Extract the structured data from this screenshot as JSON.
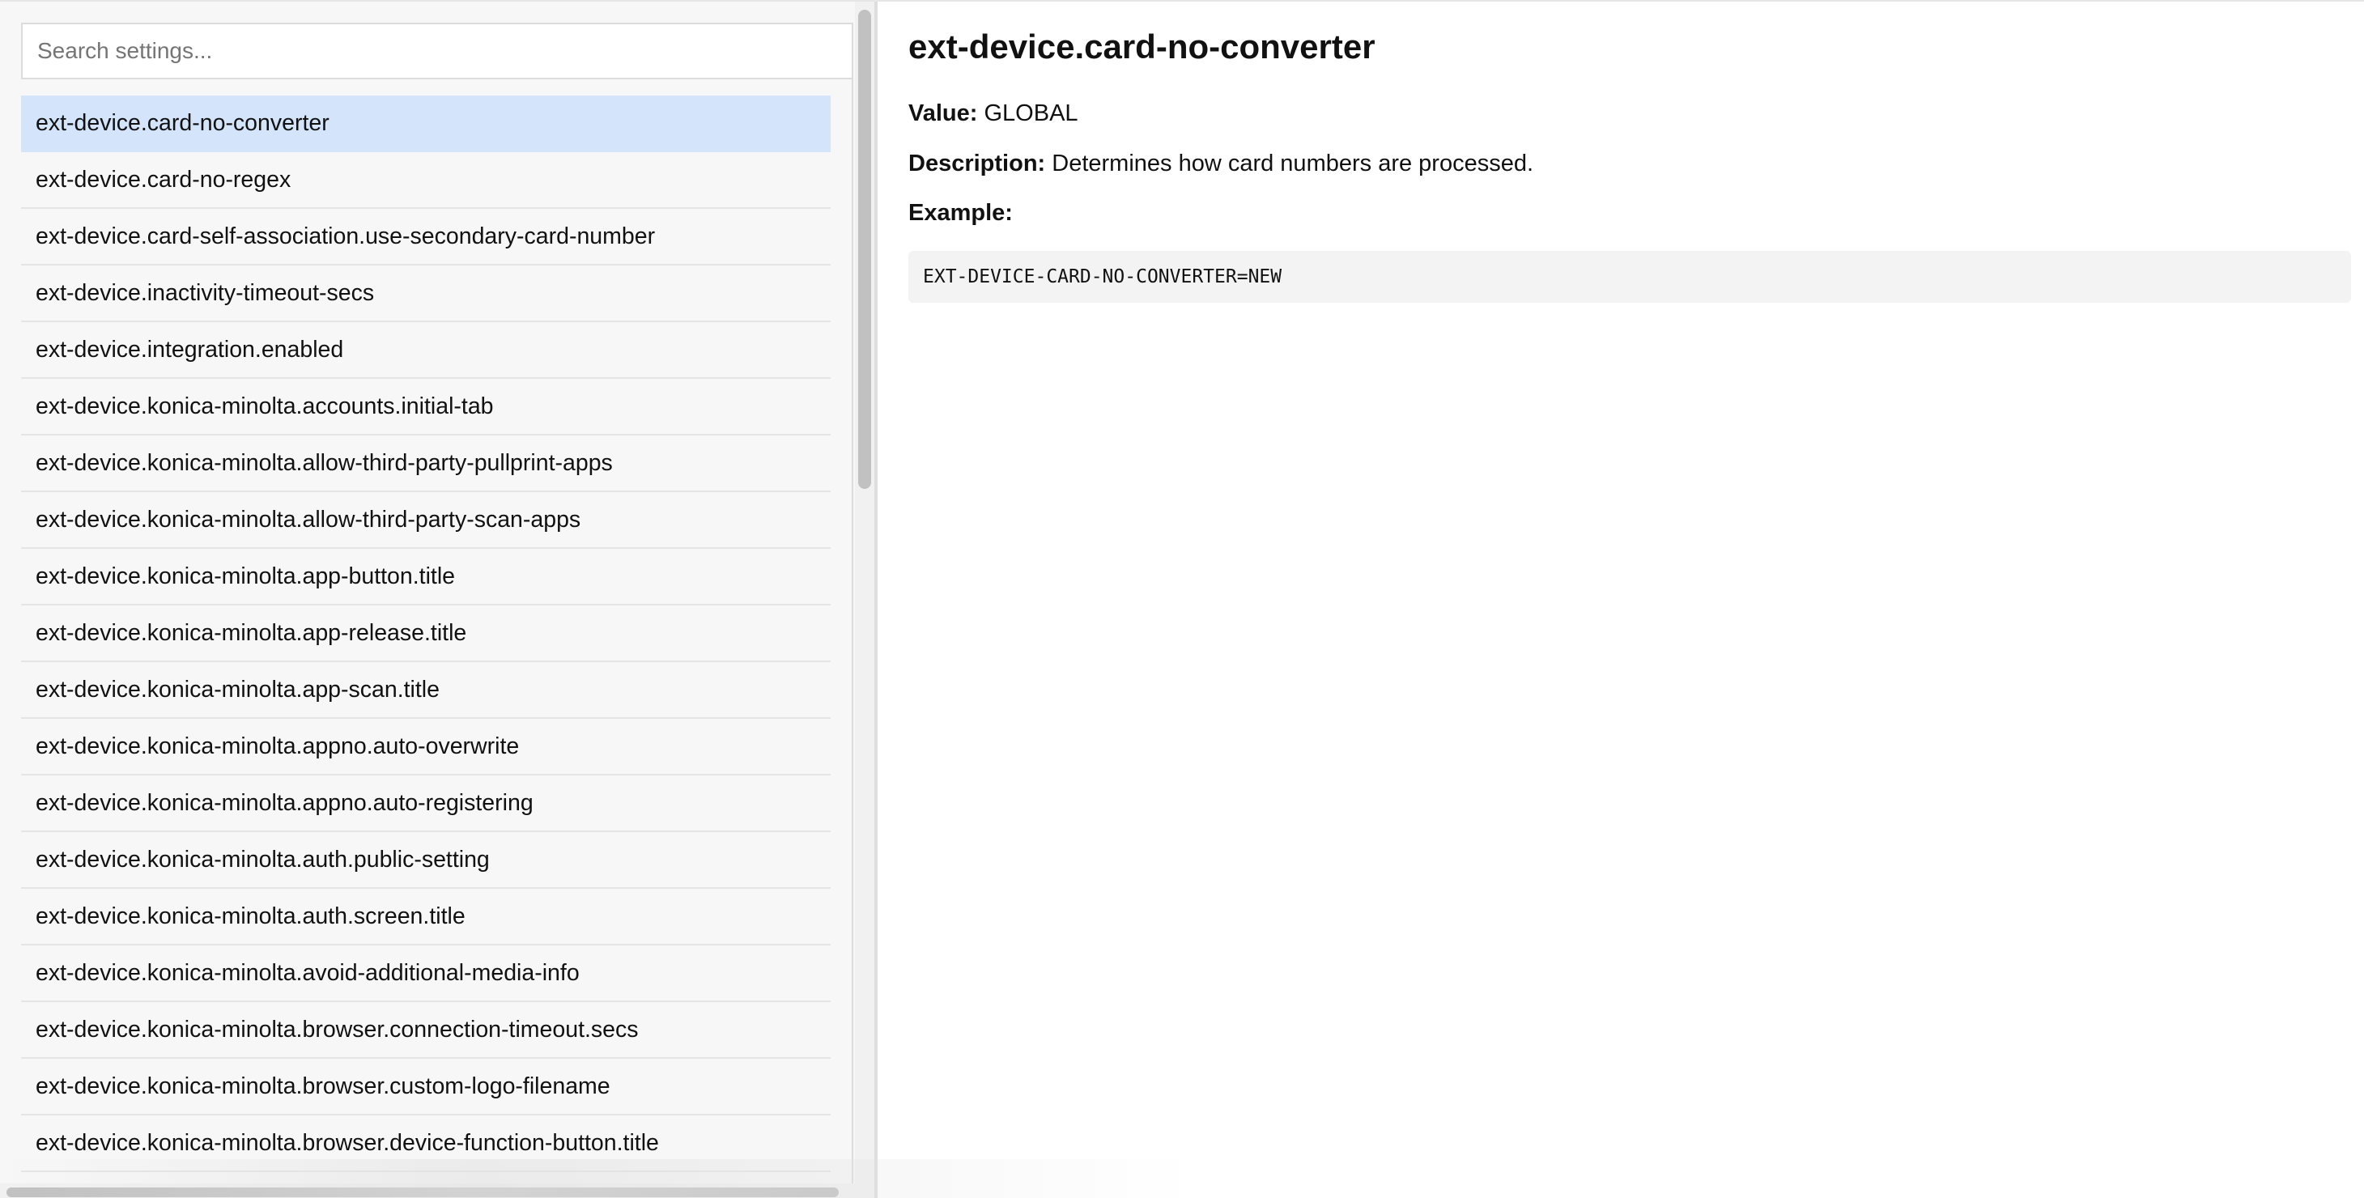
{
  "search": {
    "placeholder": "Search settings..."
  },
  "settings": [
    {
      "label": "ext-device.card-no-converter",
      "selected": true
    },
    {
      "label": "ext-device.card-no-regex"
    },
    {
      "label": "ext-device.card-self-association.use-secondary-card-number"
    },
    {
      "label": "ext-device.inactivity-timeout-secs"
    },
    {
      "label": "ext-device.integration.enabled"
    },
    {
      "label": "ext-device.konica-minolta.accounts.initial-tab"
    },
    {
      "label": "ext-device.konica-minolta.allow-third-party-pullprint-apps"
    },
    {
      "label": "ext-device.konica-minolta.allow-third-party-scan-apps"
    },
    {
      "label": "ext-device.konica-minolta.app-button.title"
    },
    {
      "label": "ext-device.konica-minolta.app-release.title"
    },
    {
      "label": "ext-device.konica-minolta.app-scan.title"
    },
    {
      "label": "ext-device.konica-minolta.appno.auto-overwrite"
    },
    {
      "label": "ext-device.konica-minolta.appno.auto-registering"
    },
    {
      "label": "ext-device.konica-minolta.auth.public-setting"
    },
    {
      "label": "ext-device.konica-minolta.auth.screen.title"
    },
    {
      "label": "ext-device.konica-minolta.avoid-additional-media-info"
    },
    {
      "label": "ext-device.konica-minolta.browser.connection-timeout.secs"
    },
    {
      "label": "ext-device.konica-minolta.browser.custom-logo-filename"
    },
    {
      "label": "ext-device.konica-minolta.browser.device-function-button.title"
    }
  ],
  "detail": {
    "title": "ext-device.card-no-converter",
    "value_label": "Value:",
    "value": "GLOBAL",
    "description_label": "Description:",
    "description": "Determines how card numbers are processed.",
    "example_label": "Example:",
    "example_code": "EXT-DEVICE-CARD-NO-CONVERTER=NEW"
  },
  "colors": {
    "selected_bg": "#d4e4fb",
    "sidebar_bg": "#f7f7f7",
    "code_bg": "#f3f3f3"
  }
}
